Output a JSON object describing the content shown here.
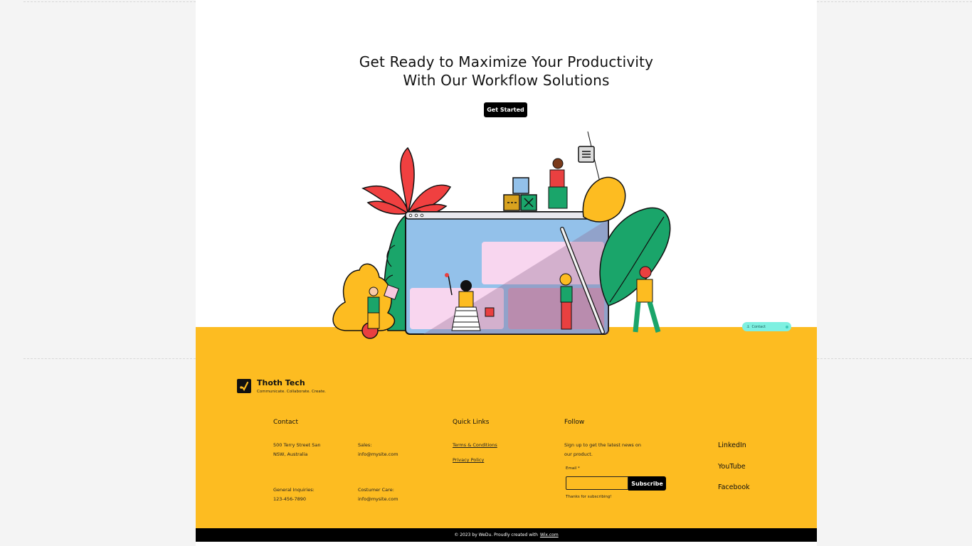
{
  "hero": {
    "title_line1": "Get Ready to Maximize Your Productivity",
    "title_line2": "With Our Workflow Solutions",
    "cta_label": "Get Started"
  },
  "contact_widget": {
    "label": "Contact"
  },
  "brand": {
    "name": "Thoth Tech",
    "tagline": "Communicate. Collaborate. Create."
  },
  "contact": {
    "heading": "Contact",
    "address_line1": "500 Terry  Street San",
    "address_line2": "NSW, Australia",
    "sales_label": "Sales:",
    "sales_email": "info@mysite.com",
    "general_label": "General Inquiries:",
    "general_phone": "123-456-7890",
    "care_label": "Costumer Care:",
    "care_email": "info@mysite.com"
  },
  "quick_links": {
    "heading": "Quick Links",
    "terms": "Terms & Conditions",
    "privacy": "Privacy Policy"
  },
  "follow": {
    "heading": "Follow",
    "signup_line1": "Sign up to get the latest news on",
    "signup_line2": "our product.",
    "email_label": "Email *",
    "email_value": "",
    "subscribe_label": "Subscribe",
    "thanks": "Thanks for subscribing!"
  },
  "social": {
    "linkedin": "LinkedIn",
    "youtube": "YouTube",
    "facebook": "Facebook"
  },
  "footer": {
    "copyright": "© 2023 by WeDu. Proudly created with",
    "wix": "Wix.com"
  },
  "colors": {
    "accent_yellow": "#fdbc21",
    "black": "#000000",
    "contact_pill": "#7ef0e1"
  }
}
